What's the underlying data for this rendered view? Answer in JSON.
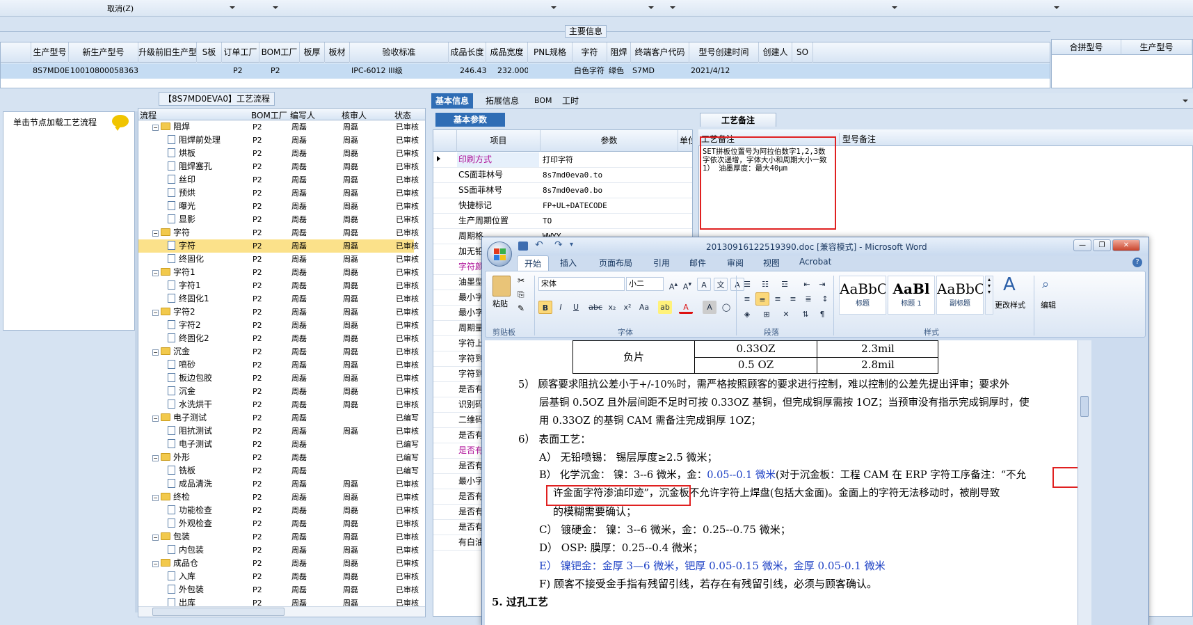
{
  "topbar": {
    "cancel": "取消(Z)"
  },
  "main_info": {
    "title": "主要信息",
    "columns": [
      "生产型号",
      "新生产型号",
      "升级前旧生产型号",
      "S板",
      "订单工厂",
      "BOM工厂",
      "板厚",
      "板材",
      "验收标准",
      "成品长度",
      "成品宽度",
      "PNL规格",
      "字符",
      "阻焊",
      "终端客户代码",
      "型号创建时间",
      "创建人",
      "SO"
    ],
    "row": {
      "生产型号": "8S7MD0EVA0",
      "新生产型号": "10010800058363",
      "订单工厂": "P2",
      "BOM工厂": "P2",
      "验收标准": "IPC-6012 III级",
      "成品长度": "246.430",
      "成品宽度": "232.000",
      "字符": "白色字符",
      "阻焊": "绿色",
      "终端客户代码": "S7MD",
      "型号创建时间": "2021/4/12"
    }
  },
  "merge_grid": {
    "columns": [
      "合拼型号",
      "生产型号"
    ]
  },
  "process": {
    "title": "【8S7MD0EVA0】工艺流程",
    "load_hint": "单击节点加载工艺流程",
    "columns": [
      "流程",
      "BOM工厂",
      "编写人",
      "核审人",
      "状态"
    ],
    "rows": [
      {
        "name": "阻焊",
        "level": 1,
        "type": "folder",
        "bom": "P2",
        "writer": "周磊",
        "reviewer": "周磊",
        "status": "已审核"
      },
      {
        "name": "阻焊前处理",
        "level": 2,
        "type": "doc",
        "bom": "P2",
        "writer": "周磊",
        "reviewer": "周磊",
        "status": "已审核"
      },
      {
        "name": "烘板",
        "level": 2,
        "type": "doc",
        "bom": "P2",
        "writer": "周磊",
        "reviewer": "周磊",
        "status": "已审核"
      },
      {
        "name": "阻焊塞孔",
        "level": 2,
        "type": "doc",
        "bom": "P2",
        "writer": "周磊",
        "reviewer": "周磊",
        "status": "已审核"
      },
      {
        "name": "丝印",
        "level": 2,
        "type": "doc",
        "bom": "P2",
        "writer": "周磊",
        "reviewer": "周磊",
        "status": "已审核"
      },
      {
        "name": "预烘",
        "level": 2,
        "type": "doc",
        "bom": "P2",
        "writer": "周磊",
        "reviewer": "周磊",
        "status": "已审核"
      },
      {
        "name": "曝光",
        "level": 2,
        "type": "doc",
        "bom": "P2",
        "writer": "周磊",
        "reviewer": "周磊",
        "status": "已审核"
      },
      {
        "name": "显影",
        "level": 2,
        "type": "doc",
        "bom": "P2",
        "writer": "周磊",
        "reviewer": "周磊",
        "status": "已审核"
      },
      {
        "name": "字符",
        "level": 1,
        "type": "folder",
        "bom": "P2",
        "writer": "周磊",
        "reviewer": "周磊",
        "status": "已审核"
      },
      {
        "name": "字符",
        "level": 2,
        "type": "doc",
        "bom": "P2",
        "writer": "周磊",
        "reviewer": "周磊",
        "status": "已审核",
        "selected": true
      },
      {
        "name": "终固化",
        "level": 2,
        "type": "doc",
        "bom": "P2",
        "writer": "周磊",
        "reviewer": "周磊",
        "status": "已审核"
      },
      {
        "name": "字符1",
        "level": 1,
        "type": "folder",
        "bom": "P2",
        "writer": "周磊",
        "reviewer": "周磊",
        "status": "已审核"
      },
      {
        "name": "字符1",
        "level": 2,
        "type": "doc",
        "bom": "P2",
        "writer": "周磊",
        "reviewer": "周磊",
        "status": "已审核"
      },
      {
        "name": "终固化1",
        "level": 2,
        "type": "doc",
        "bom": "P2",
        "writer": "周磊",
        "reviewer": "周磊",
        "status": "已审核"
      },
      {
        "name": "字符2",
        "level": 1,
        "type": "folder",
        "bom": "P2",
        "writer": "周磊",
        "reviewer": "周磊",
        "status": "已审核"
      },
      {
        "name": "字符2",
        "level": 2,
        "type": "doc",
        "bom": "P2",
        "writer": "周磊",
        "reviewer": "周磊",
        "status": "已审核"
      },
      {
        "name": "终固化2",
        "level": 2,
        "type": "doc",
        "bom": "P2",
        "writer": "周磊",
        "reviewer": "周磊",
        "status": "已审核"
      },
      {
        "name": "沉金",
        "level": 1,
        "type": "folder",
        "bom": "P2",
        "writer": "周磊",
        "reviewer": "周磊",
        "status": "已审核"
      },
      {
        "name": "喷砂",
        "level": 2,
        "type": "doc",
        "bom": "P2",
        "writer": "周磊",
        "reviewer": "周磊",
        "status": "已审核"
      },
      {
        "name": "板边包胶",
        "level": 2,
        "type": "doc",
        "bom": "P2",
        "writer": "周磊",
        "reviewer": "周磊",
        "status": "已审核"
      },
      {
        "name": "沉金",
        "level": 2,
        "type": "doc",
        "bom": "P2",
        "writer": "周磊",
        "reviewer": "周磊",
        "status": "已审核"
      },
      {
        "name": "水洗烘干",
        "level": 2,
        "type": "doc",
        "bom": "P2",
        "writer": "周磊",
        "reviewer": "周磊",
        "status": "已审核"
      },
      {
        "name": "电子测试",
        "level": 1,
        "type": "folder",
        "bom": "P2",
        "writer": "周磊",
        "reviewer": "",
        "status": "已编写"
      },
      {
        "name": "阻抗测试",
        "level": 2,
        "type": "doc",
        "bom": "P2",
        "writer": "周磊",
        "reviewer": "周磊",
        "status": "已审核"
      },
      {
        "name": "电子测试",
        "level": 2,
        "type": "doc",
        "bom": "P2",
        "writer": "周磊",
        "reviewer": "",
        "status": "已编写"
      },
      {
        "name": "外形",
        "level": 1,
        "type": "folder",
        "bom": "P2",
        "writer": "周磊",
        "reviewer": "",
        "status": "已编写"
      },
      {
        "name": "铣板",
        "level": 2,
        "type": "doc",
        "bom": "P2",
        "writer": "周磊",
        "reviewer": "",
        "status": "已编写"
      },
      {
        "name": "成品清洗",
        "level": 2,
        "type": "doc",
        "bom": "P2",
        "writer": "周磊",
        "reviewer": "周磊",
        "status": "已审核"
      },
      {
        "name": "终检",
        "level": 1,
        "type": "folder",
        "bom": "P2",
        "writer": "周磊",
        "reviewer": "周磊",
        "status": "已审核"
      },
      {
        "name": "功能检查",
        "level": 2,
        "type": "doc",
        "bom": "P2",
        "writer": "周磊",
        "reviewer": "周磊",
        "status": "已审核"
      },
      {
        "name": "外观检查",
        "level": 2,
        "type": "doc",
        "bom": "P2",
        "writer": "周磊",
        "reviewer": "周磊",
        "status": "已审核"
      },
      {
        "name": "包装",
        "level": 1,
        "type": "folder",
        "bom": "P2",
        "writer": "周磊",
        "reviewer": "周磊",
        "status": "已审核"
      },
      {
        "name": "内包装",
        "level": 2,
        "type": "doc",
        "bom": "P2",
        "writer": "周磊",
        "reviewer": "周磊",
        "status": "已审核"
      },
      {
        "name": "成品仓",
        "level": 1,
        "type": "folder",
        "bom": "P2",
        "writer": "周磊",
        "reviewer": "周磊",
        "status": "已审核"
      },
      {
        "name": "入库",
        "level": 2,
        "type": "doc",
        "bom": "P2",
        "writer": "周磊",
        "reviewer": "周磊",
        "status": "已审核"
      },
      {
        "name": "外包装",
        "level": 2,
        "type": "doc",
        "bom": "P2",
        "writer": "周磊",
        "reviewer": "周磊",
        "status": "已审核"
      },
      {
        "name": "出库",
        "level": 2,
        "type": "doc",
        "bom": "P2",
        "writer": "周磊",
        "reviewer": "周磊",
        "status": "已审核"
      }
    ]
  },
  "right_tabs": [
    "基本信息",
    "拓展信息",
    "BOM",
    "工时"
  ],
  "basic": {
    "title": "基本参数",
    "columns": [
      "项目",
      "参数",
      "单位"
    ],
    "rows": [
      {
        "k": "印刷方式",
        "v": "打印字符",
        "hl": true
      },
      {
        "k": "CS面菲林号",
        "v": "8s7md0eva0.to"
      },
      {
        "k": "SS面菲林号",
        "v": "8s7md0eva0.bo"
      },
      {
        "k": "快捷标记",
        "v": "FP+UL+DATECODE"
      },
      {
        "k": "生产周期位置",
        "v": "TO"
      },
      {
        "k": "周期格",
        "v": "WWYY"
      },
      {
        "k": "加无铅",
        "v": ""
      },
      {
        "k": "字符颜",
        "v": "",
        "hl": true
      },
      {
        "k": "油墨型",
        "v": ""
      },
      {
        "k": "最小字",
        "v": ""
      },
      {
        "k": "最小字",
        "v": ""
      },
      {
        "k": "周期量",
        "v": ""
      },
      {
        "k": "字符上",
        "v": ""
      },
      {
        "k": "字符到",
        "v": ""
      },
      {
        "k": "字符到",
        "v": ""
      },
      {
        "k": "是否有",
        "v": ""
      },
      {
        "k": "识别码",
        "v": ""
      },
      {
        "k": "二维码",
        "v": ""
      },
      {
        "k": "是否有",
        "v": ""
      },
      {
        "k": "是否有",
        "v": "",
        "hl": true
      },
      {
        "k": "是否有",
        "v": ""
      },
      {
        "k": "最小字",
        "v": ""
      },
      {
        "k": "是否有",
        "v": ""
      },
      {
        "k": "是否有",
        "v": ""
      },
      {
        "k": "是否有",
        "v": ""
      },
      {
        "k": "有白油",
        "v": ""
      }
    ]
  },
  "notes": {
    "tab": "工艺备注",
    "col1": "工艺备注",
    "col2": "型号备注",
    "text": "SET拼板位置号为阿拉伯数字1,2,3数字依次递增，字体大小和周期大小一致1） 油墨厚度：最大40μm"
  },
  "word": {
    "title": "20130916122519390.doc [兼容模式] - Microsoft Word",
    "tabs": [
      "开始",
      "插入",
      "页面布局",
      "引用",
      "邮件",
      "审阅",
      "视图",
      "Acrobat"
    ],
    "font_name": "宋体",
    "font_size": "小二",
    "groups": [
      "剪贴板",
      "字体",
      "段落",
      "样式"
    ],
    "paste": "粘贴",
    "styles": [
      {
        "sample": "AaBbC",
        "label": "标题"
      },
      {
        "sample": "AaBl",
        "label": "标题 1"
      },
      {
        "sample": "AaBbC",
        "label": "副标题"
      }
    ],
    "change_styles": "更改样式",
    "edit": "编辑",
    "table": {
      "label": "负片",
      "r1c2": "0.33OZ",
      "r1c3": "2.3mil",
      "r2c2": "0.5 OZ",
      "r2c3": "2.8mil"
    },
    "lines": [
      "5） 顾客要求阻抗公差小于+/-10%时，需严格按照顾客的要求进行控制，难以控制的公差先提出评审；要求外",
      "层基铜 0.5OZ 且外层间距不足时可按 0.33OZ 基铜，但完成铜厚需按 1OZ；当预审没有指示完成铜厚时，使",
      "用 0.33OZ 的基铜 CAM 需备注完成铜厚 1OZ；",
      "6） 表面工艺：",
      "A） 无铅喷锡：  锡层厚度≥2.5 微米；",
      "B） 化学沉金：  镍：3--6 微米，金：",
      "0.05--0.1 微米",
      "(对于沉金板：工程 CAM 在 ERP 字符工序备注：",
      "“不允",
      "许金面字符渗油印迹”",
      "，沉金板不允许字符上焊盘(包括大金面)。金面上的字符无法移动时，被削导致",
      "的模糊需要确认；",
      "C） 镀硬金：    镍：3--6 微米，金：0.25--0.75 微米；",
      "D） OSP:        膜厚：0.25--0.4 微米；",
      "E） 镍钯金：金厚 3—6 微米，钯厚 0.05-0.15 微米，金厚 0.05-0.1 微米",
      "F) 顾客不接受金手指有残留引线，若存在有残留引线，必须与顾客确认。",
      "5. 过孔工艺"
    ]
  }
}
